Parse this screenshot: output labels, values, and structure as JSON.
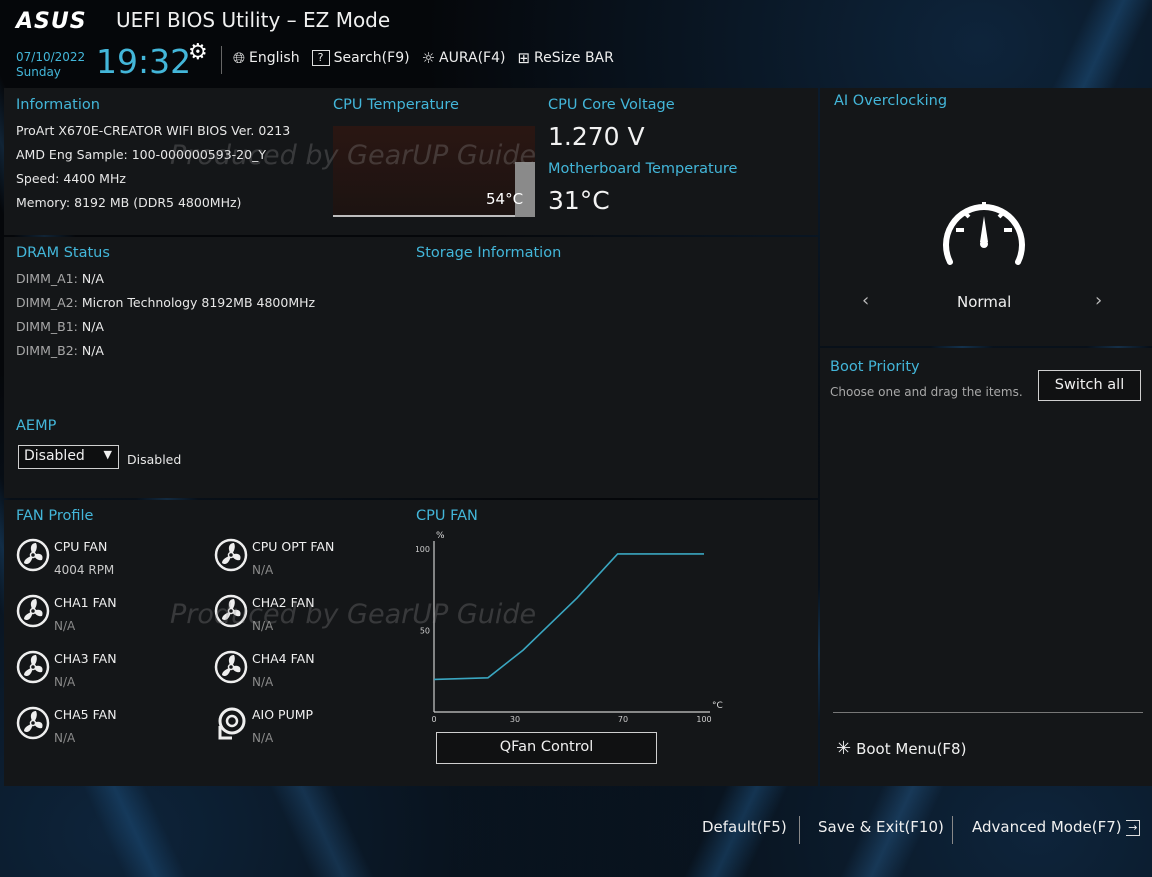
{
  "header": {
    "logo": "ASUS",
    "title": "UEFI BIOS Utility – EZ Mode",
    "date": "07/10/2022",
    "day": "Sunday",
    "time": "19:32",
    "toolbar": {
      "language": "English",
      "search": "Search(F9)",
      "aura": "AURA(F4)",
      "resize_bar": "ReSize BAR"
    }
  },
  "information": {
    "title": "Information",
    "board": "ProArt X670E-CREATOR WIFI    BIOS Ver. 0213",
    "cpu": "AMD Eng Sample: 100-000000593-20_Y",
    "speed": "Speed: 4400 MHz",
    "memory": "Memory: 8192 MB (DDR5 4800MHz)"
  },
  "cpu_temperature": {
    "title": "CPU Temperature",
    "value": "54°C"
  },
  "cpu_core_voltage": {
    "title": "CPU Core Voltage",
    "value": "1.270 V"
  },
  "motherboard_temperature": {
    "title": "Motherboard Temperature",
    "value": "31°C"
  },
  "ai_overclocking": {
    "title": "AI Overclocking",
    "mode": "Normal",
    "prev": "‹",
    "next": "›"
  },
  "dram_status": {
    "title": "DRAM Status",
    "slots": [
      {
        "slot": "DIMM_A1:",
        "value": "N/A"
      },
      {
        "slot": "DIMM_A2:",
        "value": "Micron Technology 8192MB 4800MHz"
      },
      {
        "slot": "DIMM_B1:",
        "value": "N/A"
      },
      {
        "slot": "DIMM_B2:",
        "value": "N/A"
      }
    ]
  },
  "storage_information": {
    "title": "Storage Information"
  },
  "aemp": {
    "title": "AEMP",
    "selected": "Disabled",
    "status": "Disabled"
  },
  "boot_priority": {
    "title": "Boot Priority",
    "hint": "Choose one and drag the items.",
    "switch_all": "Switch all",
    "boot_menu": "Boot Menu(F8)"
  },
  "fan_profile": {
    "title": "FAN Profile",
    "fans": [
      {
        "name": "CPU FAN",
        "value": "4004 RPM"
      },
      {
        "name": "CPU OPT FAN",
        "value": "N/A"
      },
      {
        "name": "CHA1 FAN",
        "value": "N/A"
      },
      {
        "name": "CHA2 FAN",
        "value": "N/A"
      },
      {
        "name": "CHA3 FAN",
        "value": "N/A"
      },
      {
        "name": "CHA4 FAN",
        "value": "N/A"
      },
      {
        "name": "CHA5 FAN",
        "value": "N/A"
      },
      {
        "name": "AIO PUMP",
        "value": "N/A"
      }
    ]
  },
  "cpu_fan_chart": {
    "title": "CPU FAN",
    "qfan_button": "QFan Control",
    "chart_data": {
      "type": "line",
      "title": "CPU FAN",
      "xlabel": "°C",
      "ylabel": "%",
      "x_ticks": [
        "0",
        "30",
        "70",
        "100"
      ],
      "y_ticks": [
        "50",
        "100"
      ],
      "xlim": [
        0,
        100
      ],
      "ylim": [
        0,
        100
      ],
      "series": [
        {
          "x": [
            0,
            20,
            33,
            53,
            68,
            100
          ],
          "y": [
            20,
            21,
            38,
            70,
            97,
            97
          ]
        }
      ]
    }
  },
  "footer": {
    "default": "Default(F5)",
    "save_exit": "Save & Exit(F10)",
    "advanced": "Advanced Mode(F7)"
  },
  "watermark": "Produced by GearUP Guide",
  "colors": {
    "accent": "#43b6d9",
    "panel": "#141618",
    "curve": "#3aa6c0"
  }
}
